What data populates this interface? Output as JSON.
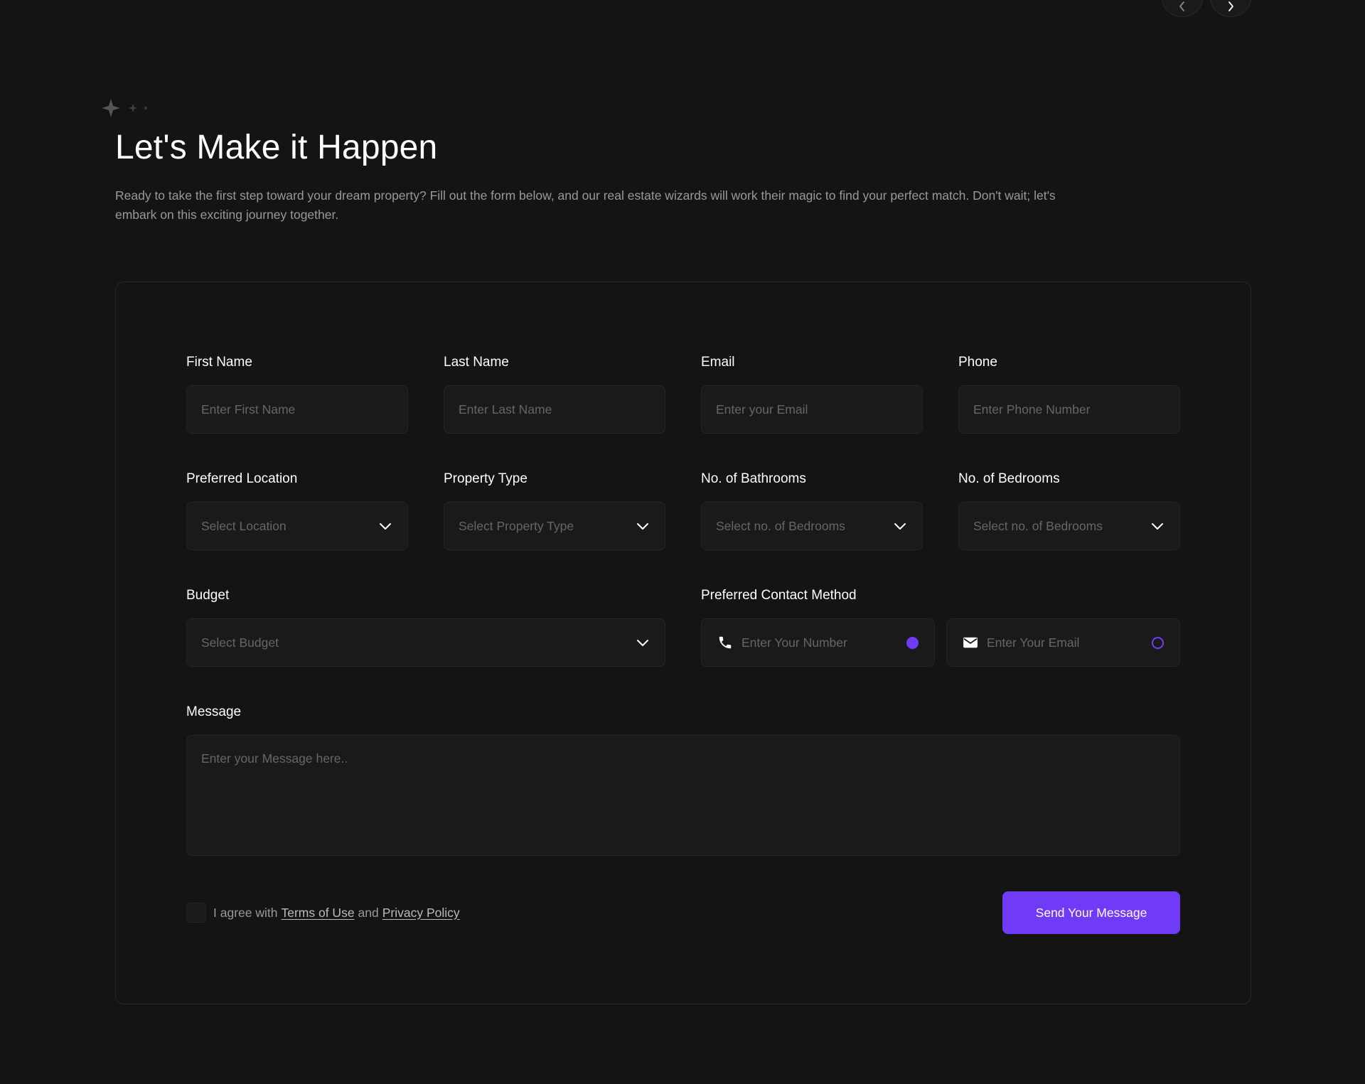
{
  "colors": {
    "background": "#141414",
    "field_background": "#1a1a1a",
    "border": "#262626",
    "accent": "#703bf7",
    "text_primary": "#ffffff",
    "text_muted": "#999999",
    "placeholder": "#666666"
  },
  "header": {
    "title": "Let's Make it Happen",
    "intro": "Ready to take the first step toward your dream property? Fill out the form below, and our real estate wizards will work their magic to find your perfect match. Don't wait; let's embark on this exciting journey together."
  },
  "nav": {
    "prev_icon": "chevron-left-icon",
    "next_icon": "chevron-right-icon"
  },
  "form": {
    "first_name": {
      "label": "First Name",
      "placeholder": "Enter First Name"
    },
    "last_name": {
      "label": "Last Name",
      "placeholder": "Enter Last Name"
    },
    "email": {
      "label": "Email",
      "placeholder": "Enter your Email"
    },
    "phone": {
      "label": "Phone",
      "placeholder": "Enter Phone Number"
    },
    "location": {
      "label": "Preferred Location",
      "value": "Select Location"
    },
    "property_type": {
      "label": "Property Type",
      "value": "Select Property Type"
    },
    "bathrooms": {
      "label": "No. of Bathrooms",
      "value": "Select no. of Bedrooms"
    },
    "bedrooms": {
      "label": "No. of Bedrooms",
      "value": "Select no. of Bedrooms"
    },
    "budget": {
      "label": "Budget",
      "value": "Select Budget"
    },
    "contact_method": {
      "label": "Preferred Contact Method",
      "phone_option": {
        "placeholder": "Enter Your Number",
        "icon": "phone-icon",
        "selected": true
      },
      "email_option": {
        "placeholder": "Enter Your Email",
        "icon": "envelope-icon",
        "selected": false
      }
    },
    "message": {
      "label": "Message",
      "placeholder": "Enter your Message here.."
    },
    "agree": {
      "prefix": "I agree with",
      "terms_link": "Terms of Use",
      "conjunction": "and",
      "privacy_link": "Privacy Policy",
      "checked": false
    },
    "submit_label": "Send Your Message"
  }
}
